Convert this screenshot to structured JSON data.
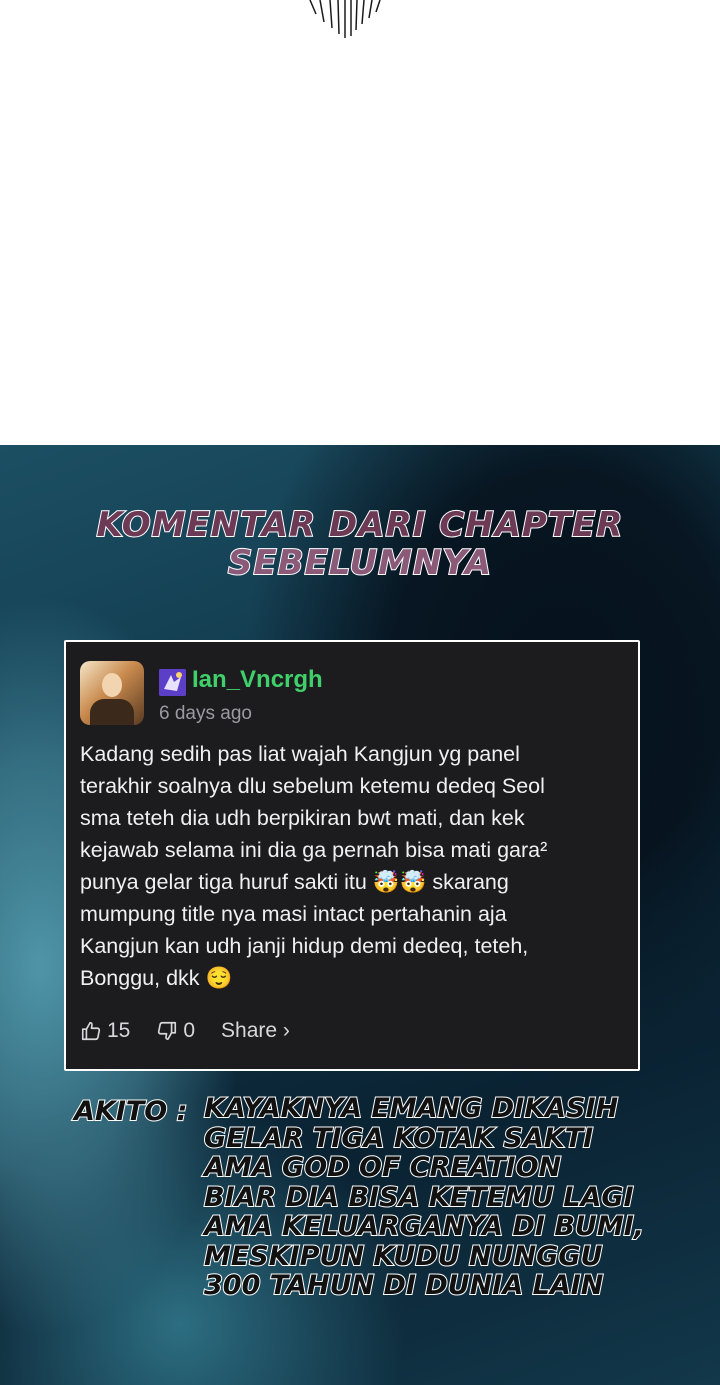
{
  "heading": {
    "line1": "KOMENTAR DARI CHAPTER",
    "line2": "SEBELUMNYA"
  },
  "comment": {
    "username": "Ian_Vncrgh",
    "timestamp": "6 days ago",
    "avatar": "user-avatar-image",
    "rank_icon": "rank-badge-icon",
    "lines": [
      "Kadang sedih pas liat wajah Kangjun yg panel",
      "terakhir soalnya dlu sebelum ketemu dedeq Seol",
      "sma teteh dia udh berpikiran bwt mati, dan kek",
      "kejawab selama ini dia ga pernah bisa mati gara²",
      "punya gelar tiga huruf sakti itu 🤯🤯 skarang",
      "mumpung title nya masi intact pertahanin aja",
      "Kangjun kan udh janji hidup demi dedeq, teteh,",
      "Bonggu, dkk 😌"
    ],
    "likes": "15",
    "dislikes": "0",
    "share_label": "Share ›",
    "colors": {
      "card_bg": "#1c1c1f",
      "username": "#3fd06a",
      "border": "#ffffff"
    }
  },
  "note": {
    "author": "AKITO :",
    "lines": [
      "KAYAKNYA EMANG DIKASIH",
      "GELAR TIGA KOTAK SAKTI",
      "AMA GOD OF CREATION",
      "BIAR DIA BISA KETEMU LAGI",
      "AMA KELUARGANYA DI BUMI,",
      "MESKIPUN KUDU NUNGGU",
      "300 TAHUN DI DUNIA LAIN"
    ]
  }
}
